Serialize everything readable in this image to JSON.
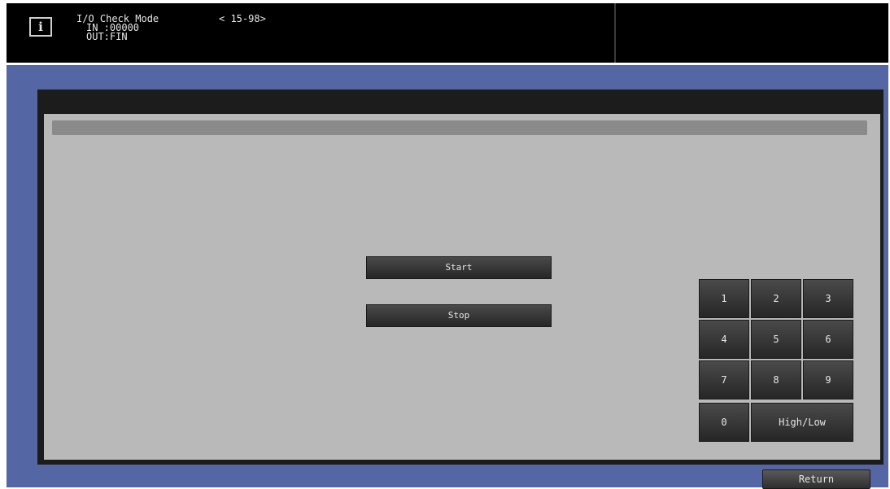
{
  "header": {
    "info_icon": "i",
    "mode_title": "I/O Check Mode",
    "code": "< 15-98>",
    "in_line": "IN :00000",
    "out_line": "OUT:FIN"
  },
  "controls": {
    "start_label": "Start",
    "stop_label": "Stop",
    "return_label": "Return"
  },
  "keypad": {
    "keys": [
      "1",
      "2",
      "3",
      "4",
      "5",
      "6",
      "7",
      "8",
      "9",
      "0",
      "High/Low"
    ]
  },
  "colors": {
    "header_bg": "#000000",
    "main_bg": "#5466a4",
    "panel_bg": "#b9b9b9",
    "button_bg": "#333333",
    "text_light": "#e6e6e6"
  }
}
